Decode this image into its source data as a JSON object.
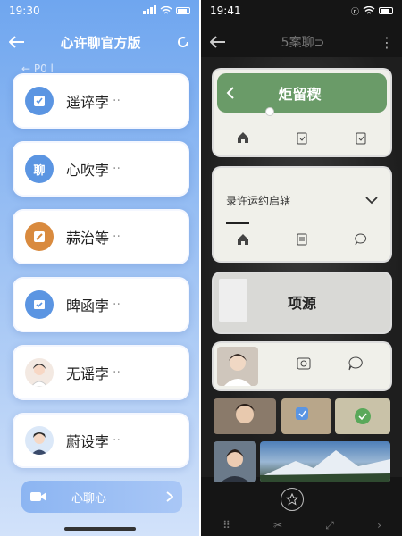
{
  "left": {
    "status_time": "19:30",
    "header_title": "心许聊官方版",
    "sub_row": "←  P0 l",
    "items": [
      {
        "label": "遥谇孛",
        "icon": "note-check-icon",
        "color": "#4a8de0"
      },
      {
        "label": "心吹孛",
        "icon": "chat-bubble-icon",
        "icon_text": "聊",
        "color": "#4a8de0"
      },
      {
        "label": "蒜治等",
        "icon": "edit-box-icon",
        "color": "#d98a3e"
      },
      {
        "label": "睥函孛",
        "icon": "check-doc-icon",
        "color": "#4a8de0"
      },
      {
        "label": "无谣孛",
        "icon": "avatar-girl-icon",
        "color": "#f3e9e2"
      },
      {
        "label": "蔚设孛",
        "icon": "avatar-boy-icon",
        "color": "#dbe8f8"
      }
    ],
    "item_suffix": "··",
    "bottom_button": "心聊心"
  },
  "right": {
    "status_time": "19:41",
    "header_title": "5案聊⊃",
    "card1_title": "炬留稧",
    "card2_title": "录许运约启辖",
    "card3_title": "项源"
  }
}
